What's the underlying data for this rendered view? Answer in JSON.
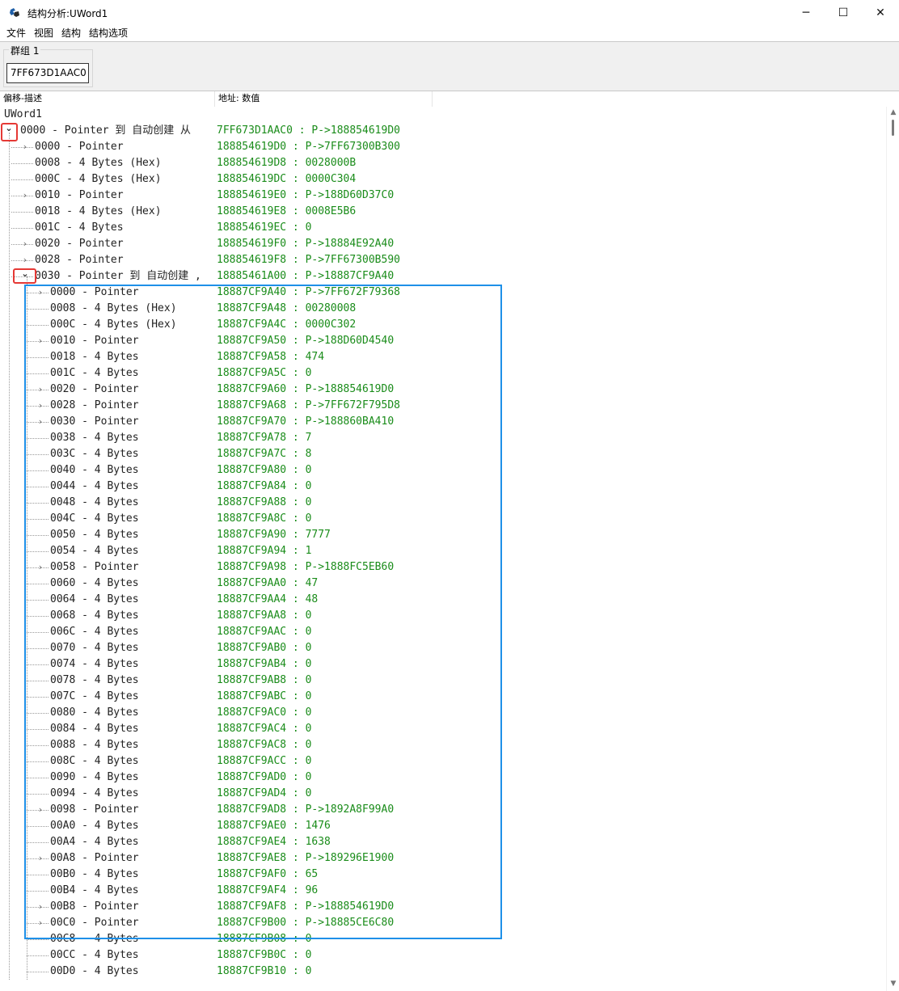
{
  "window": {
    "title": "结构分析:UWord1",
    "minimize": "─",
    "maximize": "☐",
    "close": "✕"
  },
  "menu": [
    "文件",
    "视图",
    "结构",
    "结构选项"
  ],
  "group": {
    "label": "群组 1",
    "address": "7FF673D1AAC0"
  },
  "columns": {
    "offset_desc": "偏移-描述",
    "addr_value": "地址: 数值"
  },
  "tree": {
    "root_label": "UWord1",
    "level0": [
      {
        "desc": "0000 - Pointer 到 自动创建 从",
        "addr": "7FF673D1AAC0 : P->188854619D0",
        "exp": "v",
        "highlight": true
      }
    ],
    "level1": [
      {
        "desc": "0000 - Pointer",
        "addr": "188854619D0 : P->7FF67300B300",
        "exp": ">"
      },
      {
        "desc": "0008 - 4 Bytes (Hex)",
        "addr": "188854619D8 : 0028000B",
        "exp": ""
      },
      {
        "desc": "000C - 4 Bytes (Hex)",
        "addr": "188854619DC : 0000C304",
        "exp": ""
      },
      {
        "desc": "0010 - Pointer",
        "addr": "188854619E0 : P->188D60D37C0",
        "exp": ">"
      },
      {
        "desc": "0018 - 4 Bytes (Hex)",
        "addr": "188854619E8 : 0008E5B6",
        "exp": ""
      },
      {
        "desc": "001C - 4 Bytes",
        "addr": "188854619EC : 0",
        "exp": ""
      },
      {
        "desc": "0020 - Pointer",
        "addr": "188854619F0 : P->18884E92A40",
        "exp": ">"
      },
      {
        "desc": "0028 - Pointer",
        "addr": "188854619F8 : P->7FF67300B590",
        "exp": ">"
      },
      {
        "desc": "0030 - Pointer 到 自动创建 ,",
        "addr": "18885461A00 : P->18887CF9A40",
        "exp": "v",
        "highlight": true
      }
    ],
    "level2": [
      {
        "desc": "0000 - Pointer",
        "addr": "18887CF9A40 : P->7FF672F79368",
        "exp": ">"
      },
      {
        "desc": "0008 - 4 Bytes (Hex)",
        "addr": "18887CF9A48 : 00280008",
        "exp": ""
      },
      {
        "desc": "000C - 4 Bytes (Hex)",
        "addr": "18887CF9A4C : 0000C302",
        "exp": ""
      },
      {
        "desc": "0010 - Pointer",
        "addr": "18887CF9A50 : P->188D60D4540",
        "exp": ">"
      },
      {
        "desc": "0018 - 4 Bytes",
        "addr": "18887CF9A58 : 474",
        "exp": ""
      },
      {
        "desc": "001C - 4 Bytes",
        "addr": "18887CF9A5C : 0",
        "exp": ""
      },
      {
        "desc": "0020 - Pointer",
        "addr": "18887CF9A60 : P->188854619D0",
        "exp": ">"
      },
      {
        "desc": "0028 - Pointer",
        "addr": "18887CF9A68 : P->7FF672F795D8",
        "exp": ">"
      },
      {
        "desc": "0030 - Pointer",
        "addr": "18887CF9A70 : P->188860BA410",
        "exp": ">"
      },
      {
        "desc": "0038 - 4 Bytes",
        "addr": "18887CF9A78 : 7",
        "exp": ""
      },
      {
        "desc": "003C - 4 Bytes",
        "addr": "18887CF9A7C : 8",
        "exp": ""
      },
      {
        "desc": "0040 - 4 Bytes",
        "addr": "18887CF9A80 : 0",
        "exp": ""
      },
      {
        "desc": "0044 - 4 Bytes",
        "addr": "18887CF9A84 : 0",
        "exp": ""
      },
      {
        "desc": "0048 - 4 Bytes",
        "addr": "18887CF9A88 : 0",
        "exp": ""
      },
      {
        "desc": "004C - 4 Bytes",
        "addr": "18887CF9A8C : 0",
        "exp": ""
      },
      {
        "desc": "0050 - 4 Bytes",
        "addr": "18887CF9A90 : 7777",
        "exp": ""
      },
      {
        "desc": "0054 - 4 Bytes",
        "addr": "18887CF9A94 : 1",
        "exp": ""
      },
      {
        "desc": "0058 - Pointer",
        "addr": "18887CF9A98 : P->1888FC5EB60",
        "exp": ">"
      },
      {
        "desc": "0060 - 4 Bytes",
        "addr": "18887CF9AA0 : 47",
        "exp": ""
      },
      {
        "desc": "0064 - 4 Bytes",
        "addr": "18887CF9AA4 : 48",
        "exp": ""
      },
      {
        "desc": "0068 - 4 Bytes",
        "addr": "18887CF9AA8 : 0",
        "exp": ""
      },
      {
        "desc": "006C - 4 Bytes",
        "addr": "18887CF9AAC : 0",
        "exp": ""
      },
      {
        "desc": "0070 - 4 Bytes",
        "addr": "18887CF9AB0 : 0",
        "exp": ""
      },
      {
        "desc": "0074 - 4 Bytes",
        "addr": "18887CF9AB4 : 0",
        "exp": ""
      },
      {
        "desc": "0078 - 4 Bytes",
        "addr": "18887CF9AB8 : 0",
        "exp": ""
      },
      {
        "desc": "007C - 4 Bytes",
        "addr": "18887CF9ABC : 0",
        "exp": ""
      },
      {
        "desc": "0080 - 4 Bytes",
        "addr": "18887CF9AC0 : 0",
        "exp": ""
      },
      {
        "desc": "0084 - 4 Bytes",
        "addr": "18887CF9AC4 : 0",
        "exp": ""
      },
      {
        "desc": "0088 - 4 Bytes",
        "addr": "18887CF9AC8 : 0",
        "exp": ""
      },
      {
        "desc": "008C - 4 Bytes",
        "addr": "18887CF9ACC : 0",
        "exp": ""
      },
      {
        "desc": "0090 - 4 Bytes",
        "addr": "18887CF9AD0 : 0",
        "exp": ""
      },
      {
        "desc": "0094 - 4 Bytes",
        "addr": "18887CF9AD4 : 0",
        "exp": ""
      },
      {
        "desc": "0098 - Pointer",
        "addr": "18887CF9AD8 : P->1892A8F99A0",
        "exp": ">"
      },
      {
        "desc": "00A0 - 4 Bytes",
        "addr": "18887CF9AE0 : 1476",
        "exp": ""
      },
      {
        "desc": "00A4 - 4 Bytes",
        "addr": "18887CF9AE4 : 1638",
        "exp": ""
      },
      {
        "desc": "00A8 - Pointer",
        "addr": "18887CF9AE8 : P->189296E1900",
        "exp": ">"
      },
      {
        "desc": "00B0 - 4 Bytes",
        "addr": "18887CF9AF0 : 65",
        "exp": ""
      },
      {
        "desc": "00B4 - 4 Bytes",
        "addr": "18887CF9AF4 : 96",
        "exp": ""
      },
      {
        "desc": "00B8 - Pointer",
        "addr": "18887CF9AF8 : P->188854619D0",
        "exp": ">"
      },
      {
        "desc": "00C0 - Pointer",
        "addr": "18887CF9B00 : P->18885CE6C80",
        "exp": ">"
      },
      {
        "desc": "00C8 - 4 Bytes",
        "addr": "18887CF9B08 : 0",
        "exp": ""
      },
      {
        "desc": "00CC - 4 Bytes",
        "addr": "18887CF9B0C : 0",
        "exp": ""
      },
      {
        "desc": "00D0 - 4 Bytes",
        "addr": "18887CF9B10 : 0",
        "exp": ""
      }
    ]
  }
}
